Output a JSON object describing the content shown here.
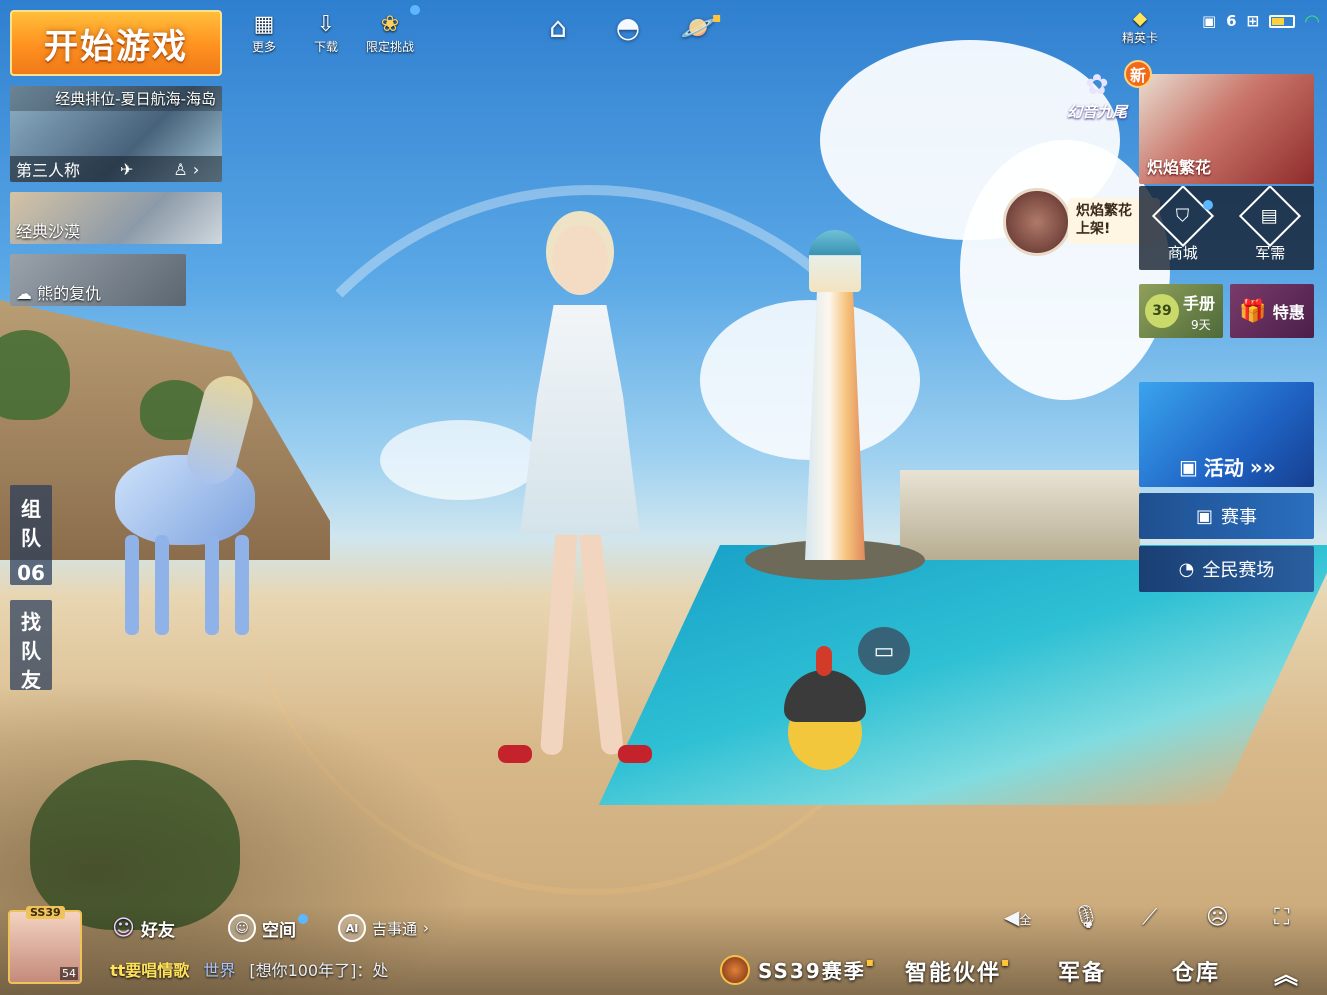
{
  "start_game": {
    "label": "开始游戏"
  },
  "top_icons": [
    {
      "label": "更多",
      "icon": "grid-icon"
    },
    {
      "label": "下载",
      "icon": "download-icon"
    },
    {
      "label": "限定挑战",
      "icon": "challenge-icon"
    }
  ],
  "modes": {
    "classic": {
      "title": "经典排位-夏日航海-海岛",
      "perspective": "第三人称"
    },
    "desert": {
      "title": "经典沙漠"
    },
    "bear": {
      "title": "熊的复仇"
    }
  },
  "side": {
    "team_chars": [
      "组",
      "队"
    ],
    "team_count": "06",
    "find_chars": [
      "找",
      "队",
      "友"
    ]
  },
  "status": {
    "elite_label": "精英卡",
    "count": "6"
  },
  "promo": {
    "event_name": "幻音九尾",
    "new_badge": "新",
    "banner_title": "炽焰繁花",
    "bubble_line1": "炽焰繁花",
    "bubble_line2": "上架!"
  },
  "shop": {
    "mall": "商城",
    "military": "军需"
  },
  "manual": {
    "label": "手册",
    "days": "9天",
    "level": "39"
  },
  "deals": {
    "label": "特惠"
  },
  "events": {
    "activity": "活动",
    "match": "赛事",
    "arena": "全民赛场"
  },
  "player": {
    "name": "tt要唱情歌",
    "level": "54",
    "season_badge": "SS39"
  },
  "chat": {
    "channel": "世界",
    "message": "[想你100年了]：处"
  },
  "social": {
    "friends": "好友",
    "space": "空间",
    "assistant": "吉事通"
  },
  "bottom_tabs": {
    "season": "SS39赛季",
    "partner": "智能伙伴",
    "equip": "军备",
    "warehouse": "仓库"
  },
  "controls": {
    "volume_label": "全"
  },
  "colors": {
    "start_orange": "#ff9120",
    "tile_blue": "#2d6bb5",
    "gift_gold": "#ffc43a"
  }
}
